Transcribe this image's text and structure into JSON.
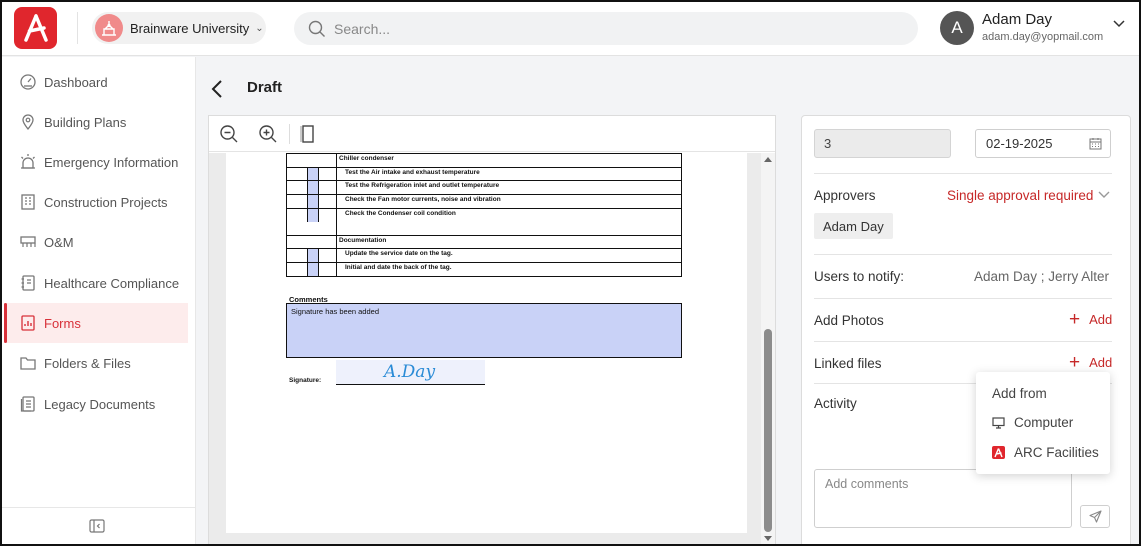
{
  "header": {
    "organization": "Brainware University",
    "search_placeholder": "Search...",
    "user": {
      "initial": "A",
      "name": "Adam Day",
      "email": "adam.day@yopmail.com"
    }
  },
  "sidebar": {
    "items": [
      {
        "label": "Dashboard",
        "icon": "dashboard-gauge-icon",
        "active": false
      },
      {
        "label": "Building Plans",
        "icon": "map-pin-icon",
        "active": false
      },
      {
        "label": "Emergency Information",
        "icon": "alarm-siren-icon",
        "active": false
      },
      {
        "label": "Construction Projects",
        "icon": "building-icon",
        "active": false
      },
      {
        "label": "O&M",
        "icon": "maintenance-icon",
        "active": false
      },
      {
        "label": "Healthcare Compliance",
        "icon": "notebook-icon",
        "active": false
      },
      {
        "label": "Forms",
        "icon": "forms-icon",
        "active": true
      },
      {
        "label": "Folders & Files",
        "icon": "folder-icon",
        "active": false
      },
      {
        "label": "Legacy Documents",
        "icon": "documents-icon",
        "active": false
      }
    ]
  },
  "page": {
    "title": "Draft"
  },
  "document": {
    "sections": [
      {
        "title": "Chiller condenser",
        "rows": [
          "Test the Air intake and exhaust temperature",
          "Test the Refrigeration inlet and outlet temperature",
          "Check the Fan motor currents, noise and vibration",
          "Check the Condenser coil condition"
        ]
      },
      {
        "title": "Documentation",
        "rows": [
          "Update the service date on the tag.",
          "Initial and date the back of the tag."
        ]
      }
    ],
    "comments_label": "Comments",
    "comments_text": "Signature has been added",
    "signature_label": "Signature:",
    "signature_text": "A.Day"
  },
  "details": {
    "number": "3",
    "date": "02-19-2025",
    "approvers_label": "Approvers",
    "approval_status": "Single approval required",
    "approver_chip": "Adam Day",
    "notify_label": "Users to notify:",
    "notify_users": "Adam Day ;   Jerry Alter",
    "photos_label": "Add Photos",
    "linked_label": "Linked files",
    "add_label": "Add",
    "activity_label": "Activity",
    "comment_placeholder": "Add comments"
  },
  "add_menu": {
    "title": "Add from",
    "items": [
      {
        "label": "Computer",
        "icon": "monitor-icon"
      },
      {
        "label": "ARC Facilities",
        "icon": "arc-logo-icon"
      }
    ]
  },
  "colors": {
    "brand": "#e0262d",
    "accent": "#c62828",
    "active_bg": "#fdecec",
    "form_fill": "#c9d2f7",
    "signature_ink": "#2a8bd6"
  }
}
